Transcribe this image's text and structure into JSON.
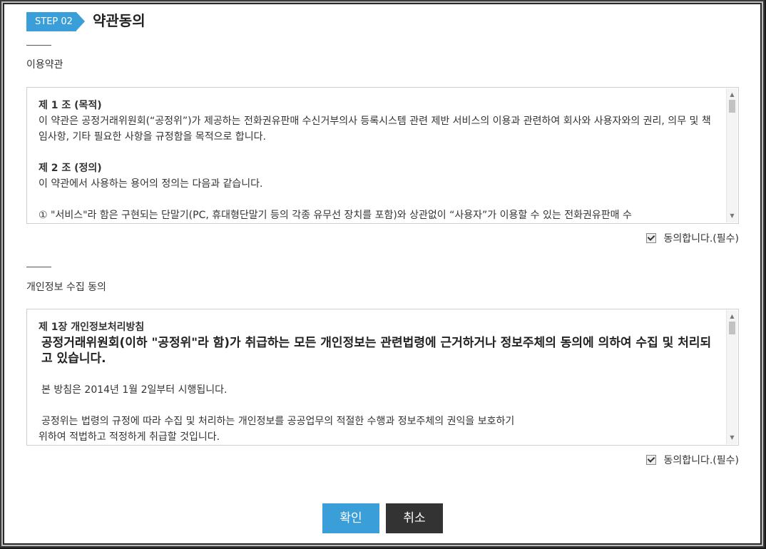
{
  "header": {
    "step_label": "STEP 02",
    "title": "약관동의"
  },
  "terms_section": {
    "title": "이용약관",
    "article1_heading": "제 1 조 (목적)",
    "article1_body": "이 약관은 공정거래위원회(“공정위”)가 제공하는 전화권유판매 수신거부의사 등록시스템 관련 제반 서비스의 이용과 관련하여 회사와 사용자와의 권리, 의무 및 책임사항, 기타 필요한 사항을 규정함을 목적으로 합니다.",
    "article2_heading": "제 2 조 (정의)",
    "article2_body": "이 약관에서 사용하는 용어의 정의는 다음과 같습니다.",
    "article2_item1": "① \"서비스\"라 함은 구현되는 단말기(PC, 휴대형단말기 등의 각종 유무선 장치를 포함)와 상관없이 “사용자”가 이용할 수 있는 전화권유판매 수",
    "agree_label": "동의합니다.(필수)",
    "agree_checked": true
  },
  "privacy_section": {
    "title": "개인정보 수집 동의",
    "heading": "제 1장 개인정보처리방침",
    "lead": "공정거래위원회(이하 \"공정위\"라 함)가 취급하는 모든 개인정보는 관련법령에 근거하거나 정보주체의 동의에 의하여 수집 및 처리되고 있습니다.",
    "para1": "본 방침은 2014년 1월 2일부터 시행됩니다.",
    "para2_line1": "공정위는 법령의 규정에 따라 수집 및 처리하는 개인정보를 공공업무의 적절한 수행과 정보주체의 권익을 보호하기",
    "para2_line2": "위하여 적법하고 적정하게 취급할 것입니다.",
    "agree_label": "동의합니다.(필수)",
    "agree_checked": true
  },
  "buttons": {
    "confirm_label": "확인",
    "cancel_label": "취소"
  },
  "colors": {
    "accent": "#3a9fd8",
    "cancel_bg": "#333333"
  },
  "icons": {
    "scroll_up": "triangle-up-icon",
    "scroll_down": "triangle-down-icon",
    "checkbox": "checkmark-icon"
  }
}
